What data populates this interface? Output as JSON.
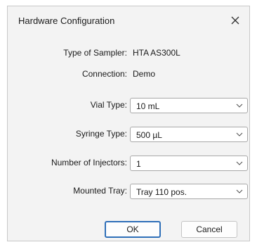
{
  "window": {
    "title": "Hardware Configuration"
  },
  "info": {
    "sampler_label": "Type of Sampler:",
    "sampler_value": "HTA AS300L",
    "connection_label": "Connection:",
    "connection_value": "Demo"
  },
  "fields": {
    "vial_type": {
      "label": "Vial Type:",
      "value": "10 mL"
    },
    "syringe_type": {
      "label": "Syringe Type:",
      "value": "500 µL"
    },
    "injectors": {
      "label": "Number of Injectors:",
      "value": "1"
    },
    "tray": {
      "label": "Mounted Tray:",
      "value": "Tray 110 pos."
    }
  },
  "buttons": {
    "ok": "OK",
    "cancel": "Cancel"
  },
  "icons": {
    "close": "close-icon",
    "dropdown": "chevron-down-icon"
  },
  "colors": {
    "dialog_bg": "#f3f3f3",
    "focus_border": "#2f6fb8"
  }
}
